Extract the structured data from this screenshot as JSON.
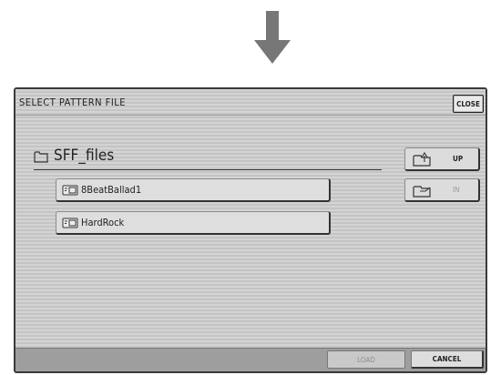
{
  "dialog": {
    "title": "SELECT PATTERN FILE",
    "close_label": "CLOSE"
  },
  "folder": {
    "name": "SFF_files",
    "icon": "folder-icon"
  },
  "files": [
    {
      "label": "8BeatBallad1",
      "icon": "pattern-file-icon"
    },
    {
      "label": "HardRock",
      "icon": "pattern-file-icon"
    }
  ],
  "side_buttons": {
    "up_label": "UP",
    "in_label": "IN",
    "in_enabled": false
  },
  "bottom": {
    "load_label": "LOAD",
    "load_enabled": false,
    "cancel_label": "CANCEL"
  },
  "colors": {
    "panel": "#cfcfcf",
    "bottom_bar": "#9e9e9e",
    "arrow": "#777777"
  }
}
